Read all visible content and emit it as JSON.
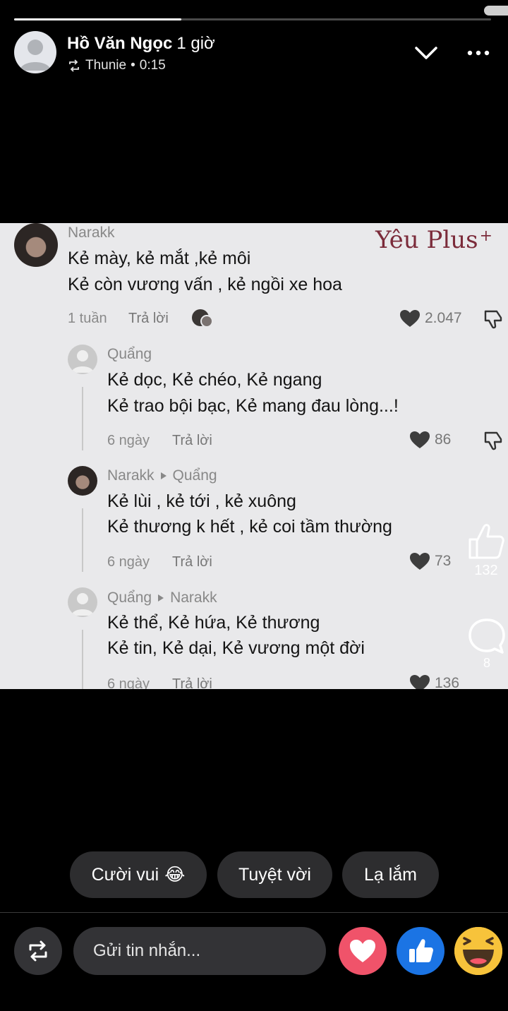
{
  "story": {
    "progress_fraction": 0.35,
    "author_name": "Hồ Văn Ngọc",
    "time_ago": "1 giờ",
    "sharer": "Thunie",
    "duration": "0:15"
  },
  "video": {
    "watermark": "Yêu Plus",
    "watermark_mark": "+",
    "comments": [
      {
        "author": "Narakk",
        "lines": [
          "Kẻ mày, kẻ mắt ,kẻ môi",
          "Kẻ còn vương vấn , kẻ ngồi xe hoa"
        ],
        "time": "1 tuần",
        "reply": "Trả lời",
        "likes": "2.047"
      },
      {
        "author": "Quẩng",
        "lines": [
          "Kẻ dọc, Kẻ chéo, Kẻ ngang",
          "Kẻ trao bội bạc, Kẻ mang đau lòng...!"
        ],
        "time": "6 ngày",
        "reply": "Trả lời",
        "likes": "86"
      },
      {
        "author": "Narakk",
        "reply_to": "Quẩng",
        "lines": [
          "Kẻ lùi , kẻ tới , kẻ xuông",
          "Kẻ thương k hết , kẻ coi tầm thường"
        ],
        "time": "6 ngày",
        "reply": "Trả lời",
        "likes": "73"
      },
      {
        "author": "Quẩng",
        "reply_to": "Narakk",
        "lines": [
          "Kẻ thể, Kẻ hứa, Kẻ thương",
          "Kẻ tin, Kẻ dại, Kẻ vương một đời"
        ],
        "time": "6 ngày",
        "reply": "Trả lời",
        "likes": "136"
      }
    ],
    "side_like_count": "132",
    "side_comment_count": "8"
  },
  "quick_replies": [
    {
      "label": "Cười vui",
      "emoji": "😂"
    },
    {
      "label": "Tuyệt vời"
    },
    {
      "label": "Lạ lắm"
    }
  ],
  "composer": {
    "placeholder": "Gửi tin nhắn..."
  },
  "icons": {
    "share": "share-icon",
    "love": "love-reaction-icon",
    "like": "like-reaction-icon",
    "haha": "haha-reaction-icon"
  },
  "colors": {
    "background": "#000000",
    "chip": "#2d2d2f",
    "love": "#f0536a",
    "like": "#1b74e4",
    "haha": "#f7c33b",
    "watermark": "#7b2b3a"
  }
}
